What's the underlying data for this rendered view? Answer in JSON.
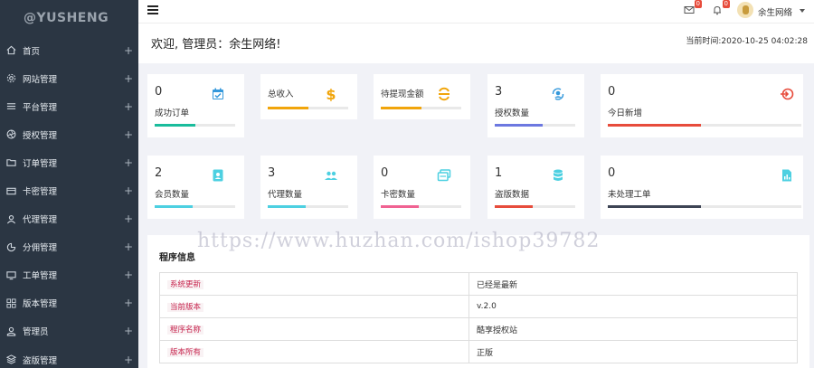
{
  "brand": "@YUSHENG",
  "sidebar": {
    "items": [
      {
        "label": "首页",
        "icon": "home-icon"
      },
      {
        "label": "网站管理",
        "icon": "gear-icon"
      },
      {
        "label": "平台管理",
        "icon": "list-icon"
      },
      {
        "label": "授权管理",
        "icon": "aperture-icon"
      },
      {
        "label": "订单管理",
        "icon": "folder-icon"
      },
      {
        "label": "卡密管理",
        "icon": "card-icon"
      },
      {
        "label": "代理管理",
        "icon": "agent-icon"
      },
      {
        "label": "分佣管理",
        "icon": "pie-icon"
      },
      {
        "label": "工单管理",
        "icon": "monitor-icon"
      },
      {
        "label": "版本管理",
        "icon": "grid-icon"
      },
      {
        "label": "管理员",
        "icon": "user-icon"
      },
      {
        "label": "盗版管理",
        "icon": "layers-icon"
      }
    ],
    "expand_symbol": "+"
  },
  "topbar": {
    "mail_badge": "0",
    "bell_badge": "0",
    "user_name": "余生网络"
  },
  "welcome": {
    "text": "欢迎, 管理员：余生网络!",
    "time": "当前时间:2020-10-25 04:02:28"
  },
  "stats": [
    {
      "value": "0",
      "label": "成功订单",
      "progress": 0.5,
      "color": "#1abc9c",
      "icon": "calendar-check-icon"
    },
    {
      "value": "",
      "label": "总收入",
      "progress": 0.5,
      "color": "#f1a50b",
      "icon": "dollar-icon"
    },
    {
      "value": "",
      "label": "待提现金额",
      "progress": 0.5,
      "color": "#f1a50b",
      "icon": "coin-icon"
    },
    {
      "value": "3",
      "label": "授权数量",
      "progress": 0.6,
      "color": "#6c78e0",
      "icon": "sync-user-icon"
    },
    {
      "value": "0",
      "label": "今日新增",
      "progress": 0.48,
      "color": "#e74c3c",
      "icon": "login-icon"
    },
    {
      "value": "2",
      "label": "会员数量",
      "progress": 0.47,
      "color": "#4dd0e1",
      "icon": "id-badge-icon"
    },
    {
      "value": "3",
      "label": "代理数量",
      "progress": 0.47,
      "color": "#4dd0e1",
      "icon": "users-icon"
    },
    {
      "value": "0",
      "label": "卡密数量",
      "progress": 0.47,
      "color": "#f06292",
      "icon": "cards-icon"
    },
    {
      "value": "1",
      "label": "盗版数据",
      "progress": 0.47,
      "color": "#e74c3c",
      "icon": "database-icon"
    },
    {
      "value": "0",
      "label": "未处理工单",
      "progress": 0.48,
      "color": "#3d4454",
      "icon": "report-icon"
    }
  ],
  "program_info": {
    "title": "程序信息",
    "rows": [
      {
        "key": "系统更新",
        "value": "已经是最新"
      },
      {
        "key": "当前版本",
        "value": "v.2.0"
      },
      {
        "key": "程序名称",
        "value": "酷享授权站"
      },
      {
        "key": "版本所有",
        "value": "正版"
      }
    ]
  },
  "watermark": "https://www.huzhan.com/ishop39782"
}
